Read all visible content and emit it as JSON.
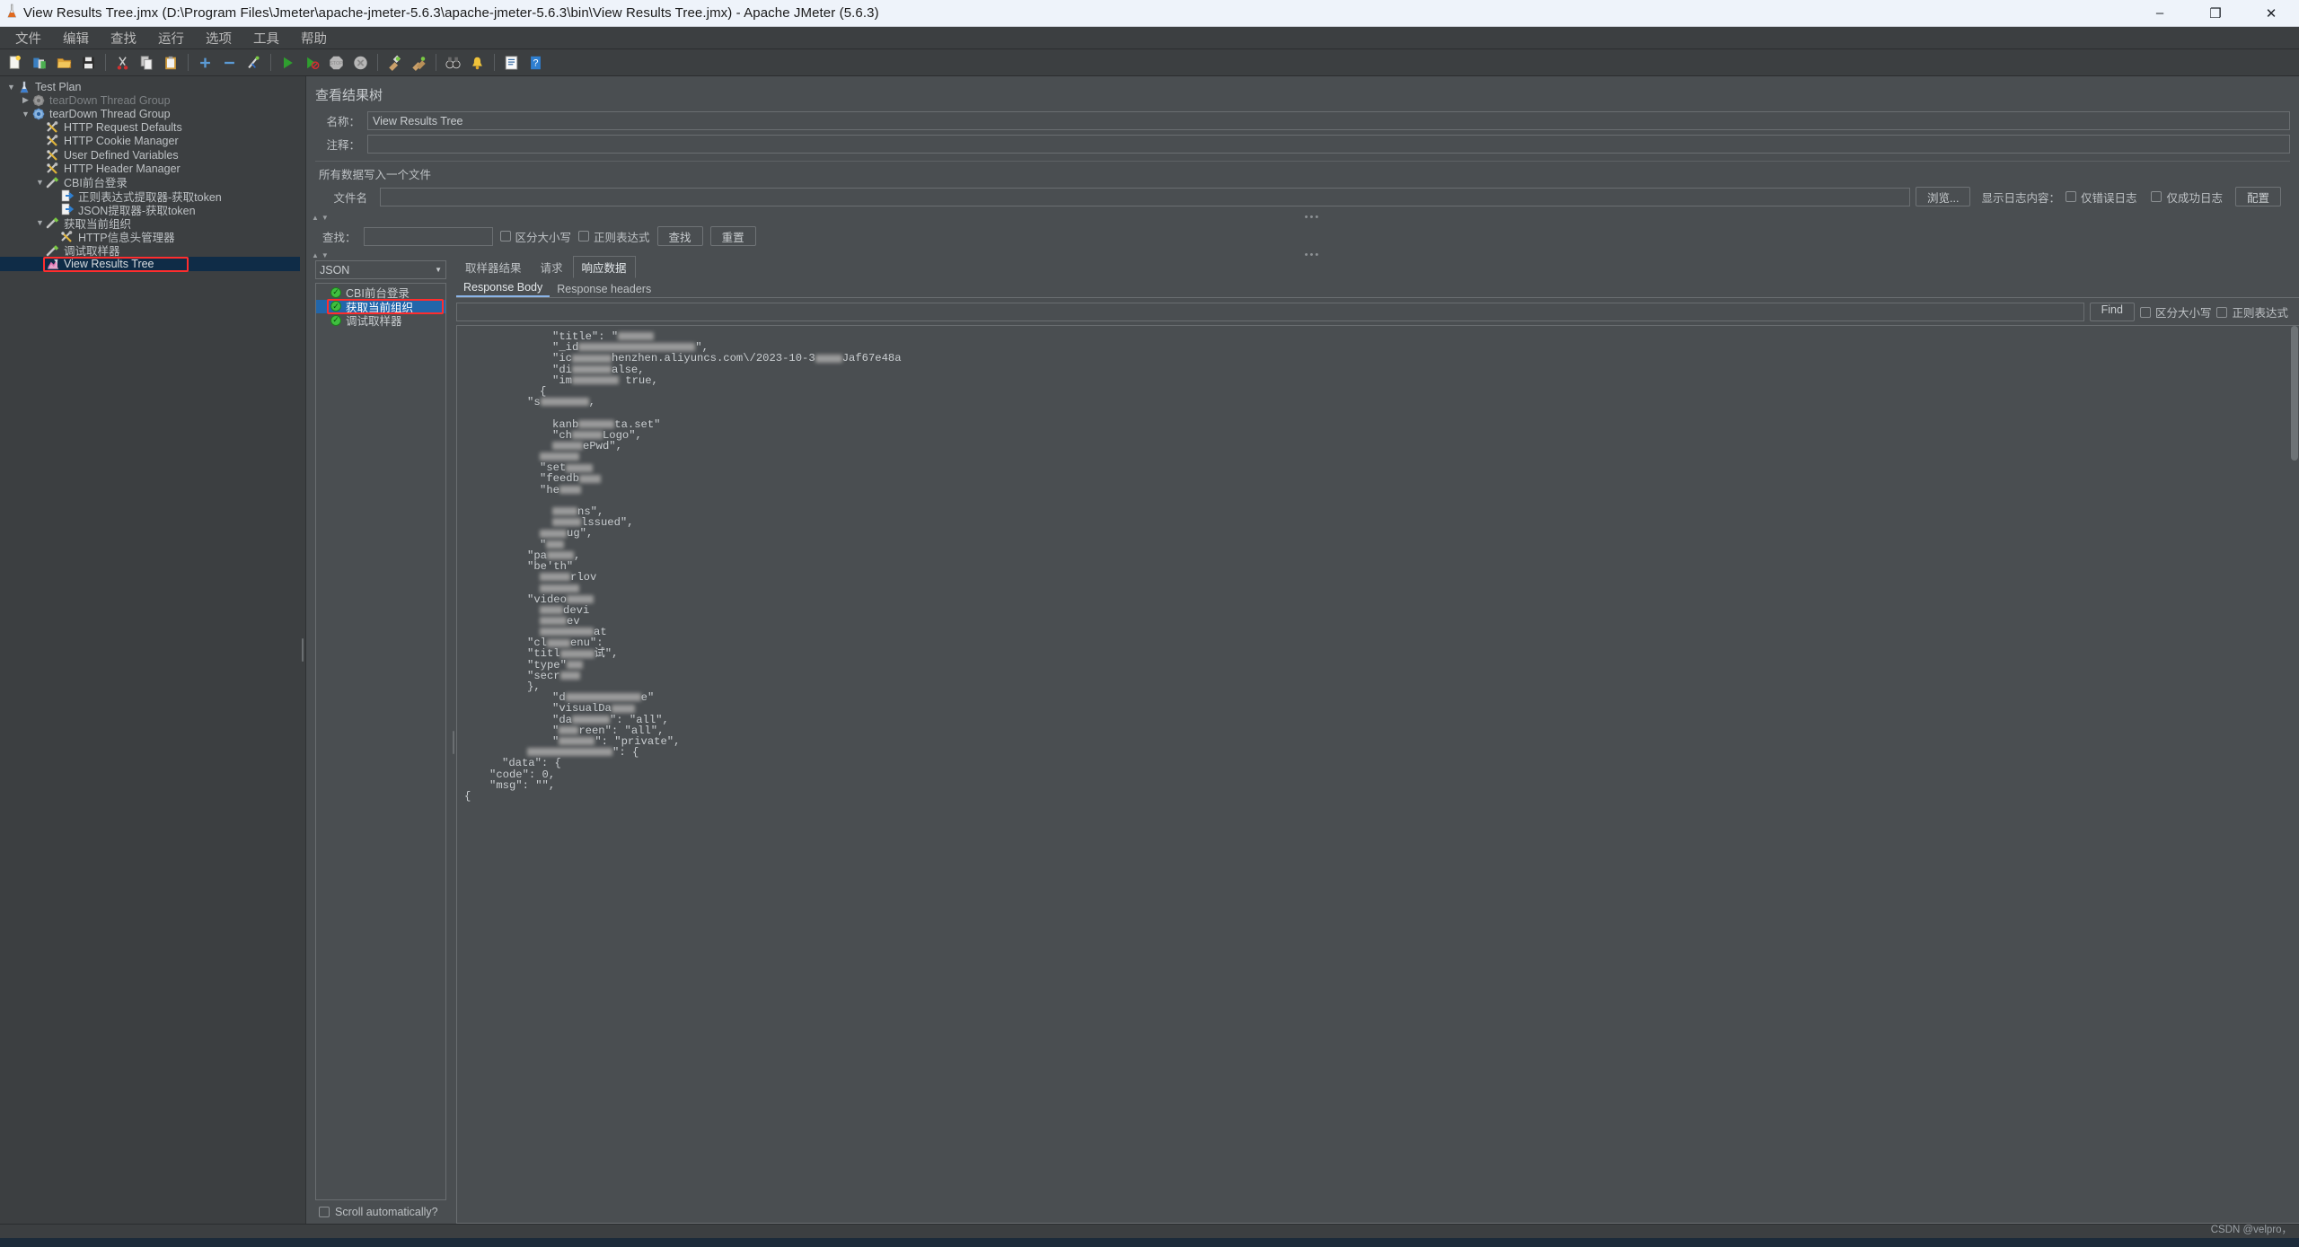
{
  "window": {
    "title": "View Results Tree.jmx (D:\\Program Files\\Jmeter\\apache-jmeter-5.6.3\\apache-jmeter-5.6.3\\bin\\View Results Tree.jmx) - Apache JMeter (5.6.3)",
    "app_icon": "jmeter-flask-icon",
    "minimize": "–",
    "maximize": "❐",
    "close": "✕"
  },
  "menubar": {
    "items": [
      {
        "label": "文件",
        "name": "menu-file"
      },
      {
        "label": "编辑",
        "name": "menu-edit"
      },
      {
        "label": "查找",
        "name": "menu-search"
      },
      {
        "label": "运行",
        "name": "menu-run"
      },
      {
        "label": "选项",
        "name": "menu-options"
      },
      {
        "label": "工具",
        "name": "menu-tools"
      },
      {
        "label": "帮助",
        "name": "menu-help"
      }
    ]
  },
  "toolbar": {
    "buttons": [
      {
        "name": "new-icon",
        "glyph": "new"
      },
      {
        "name": "templates-icon",
        "glyph": "templates"
      },
      {
        "name": "open-icon",
        "glyph": "open"
      },
      {
        "name": "save-icon",
        "glyph": "save"
      },
      {
        "sep": true
      },
      {
        "name": "cut-icon",
        "glyph": "cut"
      },
      {
        "name": "copy-icon",
        "glyph": "copy"
      },
      {
        "name": "paste-icon",
        "glyph": "paste"
      },
      {
        "sep": true
      },
      {
        "name": "expand-all-icon",
        "glyph": "plus"
      },
      {
        "name": "collapse-all-icon",
        "glyph": "minus"
      },
      {
        "name": "toggle-icon",
        "glyph": "toggle"
      },
      {
        "sep": true
      },
      {
        "name": "start-icon",
        "glyph": "start"
      },
      {
        "name": "start-no-pause-icon",
        "glyph": "start-nopause"
      },
      {
        "name": "stop-icon",
        "glyph": "stop"
      },
      {
        "name": "shutdown-icon",
        "glyph": "shutdown"
      },
      {
        "sep": true
      },
      {
        "name": "clear-icon",
        "glyph": "clear"
      },
      {
        "name": "clear-all-icon",
        "glyph": "clear-all"
      },
      {
        "sep": true
      },
      {
        "name": "search-icon",
        "glyph": "binoculars"
      },
      {
        "name": "reset-search-icon",
        "glyph": "bell"
      },
      {
        "sep": true
      },
      {
        "name": "function-helper-icon",
        "glyph": "notepad"
      },
      {
        "name": "help-icon",
        "glyph": "help"
      }
    ]
  },
  "tree": {
    "nodes": [
      {
        "label": "Test Plan",
        "depth": 0,
        "twisty": "down",
        "icon": "test-plan-icon",
        "name": "tree-node-test-plan",
        "dim": false
      },
      {
        "label": "tearDown Thread Group",
        "depth": 1,
        "twisty": "right",
        "icon": "thread-group-disabled-icon",
        "name": "tree-node-teardown-thread-group-1",
        "dim": true
      },
      {
        "label": "tearDown Thread Group",
        "depth": 1,
        "twisty": "down",
        "icon": "thread-group-icon",
        "name": "tree-node-teardown-thread-group-2",
        "dim": false
      },
      {
        "label": "HTTP Request Defaults",
        "depth": 2,
        "twisty": "",
        "icon": "config-element-icon",
        "name": "tree-node-http-request-defaults",
        "dim": false
      },
      {
        "label": "HTTP Cookie Manager",
        "depth": 2,
        "twisty": "",
        "icon": "config-element-icon",
        "name": "tree-node-http-cookie-manager",
        "dim": false
      },
      {
        "label": "User Defined Variables",
        "depth": 2,
        "twisty": "",
        "icon": "config-element-icon",
        "name": "tree-node-user-defined-variables",
        "dim": false
      },
      {
        "label": "HTTP Header Manager",
        "depth": 2,
        "twisty": "",
        "icon": "config-element-icon",
        "name": "tree-node-http-header-manager",
        "dim": false
      },
      {
        "label": "CBI前台登录",
        "depth": 2,
        "twisty": "down",
        "icon": "sampler-icon",
        "name": "tree-node-cbi-login",
        "dim": false
      },
      {
        "label": "正则表达式提取器-获取token",
        "depth": 3,
        "twisty": "",
        "icon": "post-processor-icon",
        "name": "tree-node-regex-extractor-token",
        "dim": false
      },
      {
        "label": "JSON提取器-获取token",
        "depth": 3,
        "twisty": "",
        "icon": "post-processor-icon",
        "name": "tree-node-json-extractor-token",
        "dim": false
      },
      {
        "label": "获取当前组织",
        "depth": 2,
        "twisty": "down",
        "icon": "sampler-icon",
        "name": "tree-node-get-current-org",
        "dim": false
      },
      {
        "label": "HTTP信息头管理器",
        "depth": 3,
        "twisty": "",
        "icon": "config-element-icon",
        "name": "tree-node-http-header-manager-2",
        "dim": false
      },
      {
        "label": "调试取样器",
        "depth": 2,
        "twisty": "",
        "icon": "sampler-icon",
        "name": "tree-node-debug-sampler",
        "dim": false
      },
      {
        "label": "View Results Tree",
        "depth": 2,
        "twisty": "",
        "icon": "view-results-tree-icon",
        "name": "tree-node-view-results-tree",
        "dim": false,
        "selected": true,
        "highlighted": true
      }
    ]
  },
  "panel": {
    "title": "查看结果树",
    "name_label": "名称：",
    "name_value": "View Results Tree",
    "comment_label": "注释：",
    "comment_value": "",
    "file_group_label": "所有数据写入一个文件",
    "filename_label": "文件名",
    "filename_value": "",
    "browse_button": "浏览...",
    "log_display_label": "显示日志内容：",
    "errors_only_label": "仅错误日志",
    "success_only_label": "仅成功日志",
    "configure_button": "配置"
  },
  "search": {
    "label": "查找：",
    "value": "",
    "case_sensitive_label": "区分大小写",
    "regex_label": "正则表达式",
    "find_button": "查找",
    "reset_button": "重置"
  },
  "results": {
    "renderer_selected": "JSON",
    "renderer_arrow": "▼",
    "samplers": [
      {
        "label": "CBI前台登录",
        "status": "success",
        "name": "sampler-result-cbi-login",
        "selected": false
      },
      {
        "label": "获取当前组织",
        "status": "success",
        "name": "sampler-result-get-current-org",
        "selected": true,
        "highlighted": true
      },
      {
        "label": "调试取样器",
        "status": "success",
        "name": "sampler-result-debug-sampler",
        "selected": false
      }
    ],
    "scroll_automatically_label": "Scroll automatically?",
    "tabs": [
      {
        "label": "取样器结果",
        "name": "tab-sampler-result",
        "active": false
      },
      {
        "label": "请求",
        "name": "tab-request",
        "active": false
      },
      {
        "label": "响应数据",
        "name": "tab-response-data",
        "active": true
      }
    ],
    "subtabs": [
      {
        "label": "Response Body",
        "name": "subtab-response-body",
        "active": true
      },
      {
        "label": "Response headers",
        "name": "subtab-response-headers",
        "active": false
      }
    ],
    "find_value": "",
    "find_button": "Find",
    "find_case_label": "区分大小写",
    "find_regex_label": "正则表达式"
  },
  "response_body": {
    "lines": [
      {
        "indent": 0,
        "text": "{"
      },
      {
        "indent": 2,
        "text": "\"msg\": \"\","
      },
      {
        "indent": 2,
        "text": "\"code\": 0,"
      },
      {
        "indent": 3,
        "text": "\"data\": {"
      },
      {
        "indent": 5,
        "text": "",
        "blur": [
          0,
          95
        ],
        "suffix": "\": {"
      },
      {
        "indent": 7,
        "text": "\"",
        "blur": [
          18,
          40
        ],
        "suffix": "\": \"private\","
      },
      {
        "indent": 7,
        "text": "\"",
        "blur": [
          14,
          22
        ],
        "suffix": "reen\": \"all\","
      },
      {
        "indent": 7,
        "text": "\"da",
        "blur": [
          26,
          42
        ],
        "suffix": "\": \"all\","
      },
      {
        "indent": 7,
        "text": "\"visualDa",
        "blur": [
          62,
          26
        ],
        "suffix": ""
      },
      {
        "indent": 7,
        "text": "\"d",
        "blur": [
          20,
          84
        ],
        "suffix": "e\""
      },
      {
        "indent": 5,
        "text": "},"
      },
      {
        "indent": 5,
        "text": "\"secr",
        "blur": [
          40,
          22
        ],
        "suffix": ""
      },
      {
        "indent": 5,
        "text": "\"type\"",
        "blur": [
          48,
          18
        ],
        "suffix": ""
      },
      {
        "indent": 5,
        "text": "\"titl",
        "blur": [
          34,
          38
        ],
        "suffix": "试\","
      },
      {
        "indent": 5,
        "text": "\"cl",
        "blur": [
          22,
          26
        ],
        "suffix": "enu\":"
      },
      {
        "indent": 6,
        "text": "",
        "blur": [
          28,
          60
        ],
        "suffix": "at"
      },
      {
        "indent": 6,
        "text": "",
        "blur": [
          14,
          30
        ],
        "suffix": "ev"
      },
      {
        "indent": 6,
        "text": "",
        "blur": [
          10,
          26
        ],
        "suffix": "devi"
      },
      {
        "indent": 5,
        "text": "\"video",
        "blur": [
          58,
          30
        ],
        "suffix": ""
      },
      {
        "indent": 6,
        "text": "",
        "blur": [
          8,
          44
        ],
        "suffix": ""
      },
      {
        "indent": 6,
        "text": "",
        "blur": [
          14,
          34
        ],
        "suffix": "rlov"
      },
      {
        "indent": 5,
        "text": "\"be'th\""
      },
      {
        "indent": 5,
        "text": "\"pa",
        "blur": [
          26,
          30
        ],
        "suffix": ","
      },
      {
        "indent": 6,
        "text": "\"",
        "blur": [
          6,
          20
        ],
        "suffix": ""
      },
      {
        "indent": 6,
        "text": "",
        "blur": [
          24,
          30
        ],
        "suffix": "ug\","
      },
      {
        "indent": 7,
        "text": "",
        "blur": [
          36,
          32
        ],
        "suffix": "lssued\","
      },
      {
        "indent": 7,
        "text": "",
        "blur": [
          36,
          28
        ],
        "suffix": "ns\","
      },
      {
        "indent": 6,
        "text": ""
      },
      {
        "indent": 6,
        "text": "\"he",
        "blur": [
          20,
          24
        ],
        "suffix": ""
      },
      {
        "indent": 6,
        "text": "\"feedb",
        "blur": [
          46,
          24
        ],
        "suffix": ""
      },
      {
        "indent": 6,
        "text": "\"set",
        "blur": [
          30,
          30
        ],
        "suffix": ""
      },
      {
        "indent": 6,
        "text": "",
        "blur": [
          20,
          44
        ],
        "suffix": ""
      },
      {
        "indent": 7,
        "text": "",
        "blur": [
          26,
          34
        ],
        "suffix": "ePwd\","
      },
      {
        "indent": 7,
        "text": "\"ch",
        "blur": [
          24,
          34
        ],
        "suffix": "Logo\","
      },
      {
        "indent": 7,
        "text": "kanb",
        "blur": [
          38,
          40
        ],
        "suffix": "ta.set\""
      },
      {
        "indent": 6,
        "text": ""
      },
      {
        "indent": 5,
        "text": "\"s",
        "blur": [
          14,
          54
        ],
        "suffix": ","
      },
      {
        "indent": 6,
        "text": "{"
      },
      {
        "indent": 7,
        "text": "\"im",
        "blur": [
          26,
          52
        ],
        "suffix": " true,"
      },
      {
        "indent": 7,
        "text": "\"di",
        "blur": [
          22,
          44
        ],
        "suffix": "alse,"
      },
      {
        "indent": 7,
        "text": "\"ic",
        "blur": [
          24,
          44
        ],
        "suffix": "henzhen.aliyuncs.com\\/2023-10-3",
        "blur2": [
          16,
          30
        ],
        "suffix2": "Jaf67e48a"
      },
      {
        "indent": 7,
        "text": "\"_id",
        "blur": [
          34,
          130
        ],
        "suffix": "\","
      },
      {
        "indent": 7,
        "text": "\"title\": \"",
        "blur": [
          34,
          40
        ],
        "suffix": ""
      }
    ]
  },
  "statusbar": {
    "watermark": "CSDN @velpro，"
  },
  "colors": {
    "accent_blue": "#2266aa",
    "highlight_red": "#ff2d2d",
    "selection_navy": "#0f2c47",
    "panel_bg": "#4a4e51",
    "chrome_bg": "#3c3f41",
    "text_primary": "#bdc1c4",
    "text_dim": "#7d8184",
    "success_green": "#3fbf3f"
  }
}
